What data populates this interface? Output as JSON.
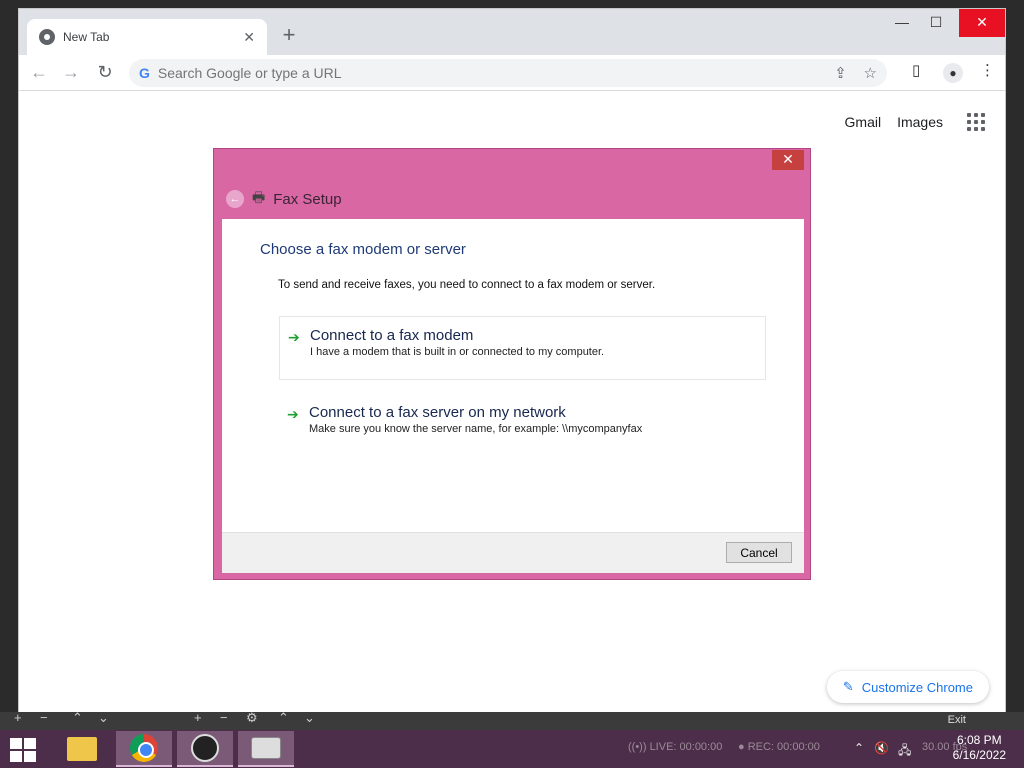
{
  "browser": {
    "tab_title": "New Tab",
    "tab_close": "✕",
    "new_tab": "+",
    "minimize": "—",
    "maximize": "☐",
    "close": "✕",
    "omnibox_placeholder": "Search Google or type a URL",
    "google_letter": "G"
  },
  "ntp": {
    "gmail": "Gmail",
    "images": "Images",
    "customize": "Customize Chrome"
  },
  "fax_dialog": {
    "title": "Fax Setup",
    "close": "✕",
    "heading": "Choose a fax modem or server",
    "description": "To send and receive faxes, you need to connect to a fax modem or server.",
    "options": [
      {
        "title": "Connect to a fax modem",
        "subtitle": "I have a modem that is built in or connected to my computer."
      },
      {
        "title": "Connect to a fax server on my network",
        "subtitle": "Make sure you know the server name, for example: \\\\mycompanyfax"
      }
    ],
    "cancel": "Cancel",
    "arrow_color": "#20a030"
  },
  "obs": {
    "exit": "Exit",
    "live": "LIVE: 00:00:00",
    "rec": "REC: 00:00:00",
    "fps": "30.00 fps"
  },
  "taskbar": {
    "time": "6:08 PM",
    "date": "6/16/2022"
  }
}
